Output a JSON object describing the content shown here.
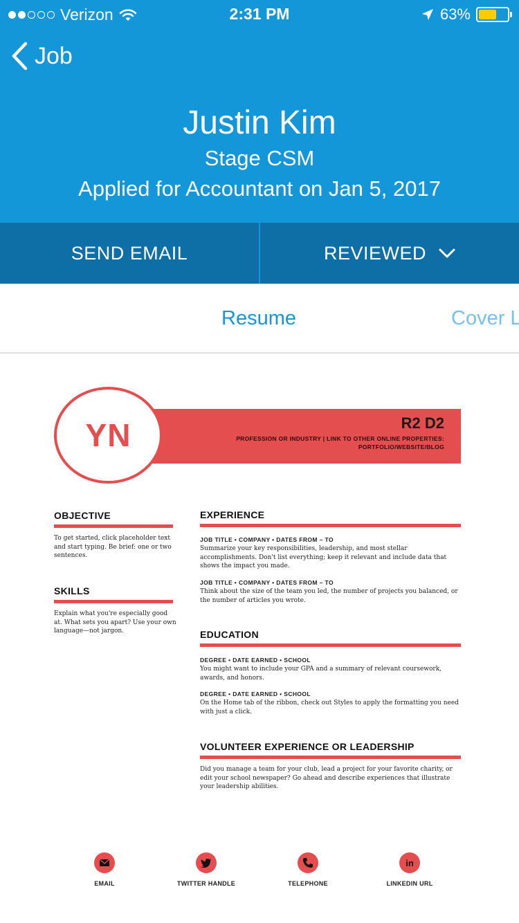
{
  "status_bar": {
    "carrier": "Verizon",
    "time": "2:31 PM",
    "battery": "63%",
    "battery_level": 0.63,
    "battery_color": "#ffcc00",
    "signal_bars": 2,
    "signal_total": 5
  },
  "nav": {
    "back_label": "Job"
  },
  "candidate": {
    "name": "Justin Kim",
    "stage": "Stage CSM",
    "applied": "Applied for Accountant on Jan 5, 2017"
  },
  "actions": {
    "send_email": "SEND EMAIL",
    "status": "REVIEWED"
  },
  "tabs": [
    {
      "label": "Resume",
      "active": true
    },
    {
      "label": "Cover L",
      "active": false
    }
  ],
  "colors": {
    "header": "#1497d8",
    "action_bar": "#0d6fa6",
    "accent": "#e54e4f"
  },
  "resume": {
    "monogram": "YN",
    "name": "R2 D2",
    "subtitle_line1": "PROFESSION OR INDUSTRY | LINK TO OTHER ONLINE PROPERTIES:",
    "subtitle_line2": "PORTFOLIO/WEBSITE/BLOG",
    "objective": {
      "title": "OBJECTIVE",
      "text": "To get started, click placeholder text and start typing. Be brief: one or two sentences."
    },
    "skills": {
      "title": "SKILLS",
      "text": "Explain what you're especially good at. What sets you apart? Use your own language—not jargon."
    },
    "experience": {
      "title": "EXPERIENCE",
      "items": [
        {
          "head": "JOB TITLE • COMPANY • DATES FROM – TO",
          "text": "Summarize your key responsibilities, leadership, and most stellar accomplishments. Don't list everything; keep it relevant and include data that shows the impact you made."
        },
        {
          "head": "JOB TITLE • COMPANY • DATES FROM – TO",
          "text": "Think about the size of the team you led, the number of projects you balanced, or the number of articles you wrote."
        }
      ]
    },
    "education": {
      "title": "EDUCATION",
      "items": [
        {
          "head": "DEGREE • DATE EARNED • SCHOOL",
          "text": "You might want to include your GPA and a summary of relevant coursework, awards, and honors."
        },
        {
          "head": "DEGREE • DATE EARNED • SCHOOL",
          "text": "On the Home tab of the ribbon, check out Styles to apply the formatting you need with just a click."
        }
      ]
    },
    "volunteer": {
      "title": "VOLUNTEER EXPERIENCE OR LEADERSHIP",
      "text": "Did you manage a team for your club, lead a project for your favorite charity, or edit your school newspaper? Go ahead and describe experiences that illustrate your leadership abilities."
    },
    "contacts": [
      {
        "icon": "email-icon",
        "label": "EMAIL"
      },
      {
        "icon": "twitter-icon",
        "label": "TWITTER HANDLE"
      },
      {
        "icon": "phone-icon",
        "label": "TELEPHONE"
      },
      {
        "icon": "linkedin-icon",
        "label": "LINKEDIN URL"
      }
    ]
  }
}
